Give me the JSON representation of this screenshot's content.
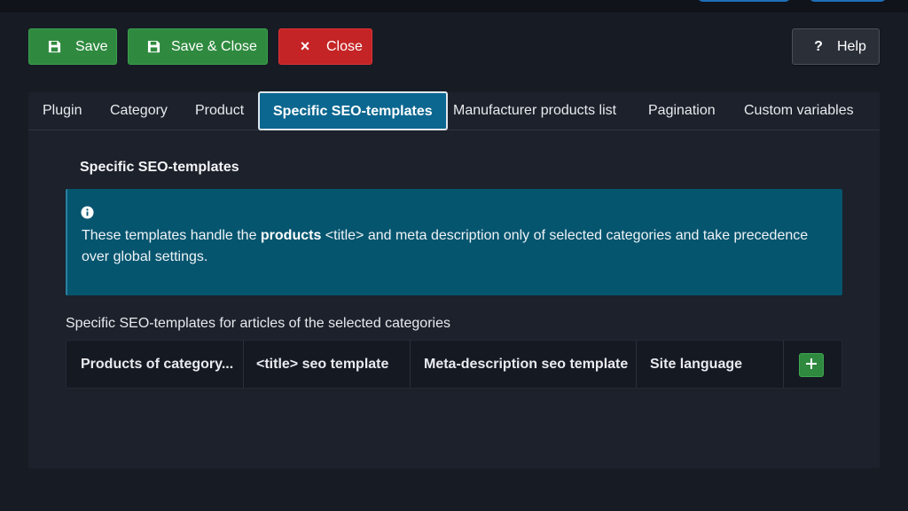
{
  "toolbar": {
    "save_label": "Save",
    "save_close_label": "Save & Close",
    "close_label": "Close",
    "help_label": "Help",
    "close_glyph": "×",
    "help_glyph": "?"
  },
  "tabs": [
    {
      "label": "Plugin",
      "active": false
    },
    {
      "label": "Category",
      "active": false
    },
    {
      "label": "Product",
      "active": false
    },
    {
      "label": "Specific SEO-templates",
      "active": true
    },
    {
      "label": "Manufacturer products list",
      "active": false
    },
    {
      "label": "Pagination",
      "active": false
    },
    {
      "label": "Custom variables",
      "active": false
    }
  ],
  "section": {
    "title": "Specific SEO-templates"
  },
  "alert": {
    "text_before": "These templates handle the ",
    "text_bold": "products",
    "text_after": " <title> and meta description only of selected categories and take precedence over global settings.",
    "icon": "info-icon"
  },
  "table": {
    "caption": "Specific SEO-templates for articles of the selected categories",
    "columns": [
      "Products of category...",
      "<title> seo template",
      "Meta-description seo template",
      "Site language"
    ],
    "add_icon": "plus-icon"
  },
  "colors": {
    "background": "#171b24",
    "success": "#2f8a3f",
    "danger": "#c42425",
    "info": "#06556f",
    "active_tab": "#0b6790"
  }
}
